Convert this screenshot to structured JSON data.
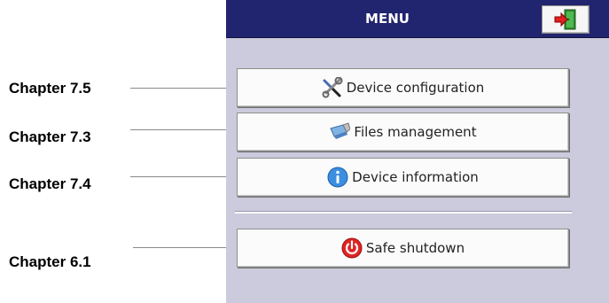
{
  "annotations": [
    {
      "label": "Chapter 7.5"
    },
    {
      "label": "Chapter 7.3"
    },
    {
      "label": "Chapter 7.4"
    },
    {
      "label": "Chapter 6.1"
    }
  ],
  "menu": {
    "title": "MENU",
    "exit_icon": "exit-door-icon",
    "items": [
      {
        "label": "Device configuration",
        "icon": "wrench-screwdriver-icon"
      },
      {
        "label": "Files management",
        "icon": "usb-drive-icon"
      },
      {
        "label": "Device information",
        "icon": "info-icon"
      },
      {
        "label": "Safe shutdown",
        "icon": "power-icon"
      }
    ]
  },
  "colors": {
    "header": "#21246e",
    "screen_background": "#cccbdd",
    "button": "#fbfbfb"
  }
}
